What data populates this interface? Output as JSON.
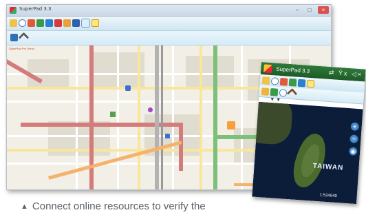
{
  "desktop": {
    "title": "SuperPad 3.3",
    "toolbar_icons": [
      "folder-open-icon",
      "search-icon",
      "edit-pen-icon",
      "road-icon",
      "gps-icon",
      "layers-icon",
      "map-icon",
      "globe-icon",
      "satellite-icon",
      "document-icon"
    ],
    "secondary_icons": [
      "satellite-link-icon",
      "hammer-tool-icon"
    ],
    "map_corner_text": "SuperPad Pro Demo"
  },
  "mobile": {
    "title": "SuperPad 3.3",
    "status_icons": "⇄ Ŷx ◁×",
    "toolbar_icons": [
      "folder-open-icon",
      "search-icon",
      "edit-pen-icon",
      "road-icon",
      "gps-icon",
      "document-icon"
    ],
    "secondary_icons": [
      "layers-icon",
      "edit-icon",
      "search-icon",
      "hammer-tool-icon"
    ],
    "map_label": "TAIWAN",
    "scale_text": "1:524649"
  },
  "caption": "Connect online resources to verify the",
  "colors": {
    "title_green": "#2e7a3a",
    "toolbar_blue": "#cfe6f3",
    "map_bg": "#f2efe6",
    "road_red": "#d47b7b",
    "road_green": "#7cc07a",
    "sea": "#0c1d3a",
    "caption_gray": "#5a6168"
  }
}
